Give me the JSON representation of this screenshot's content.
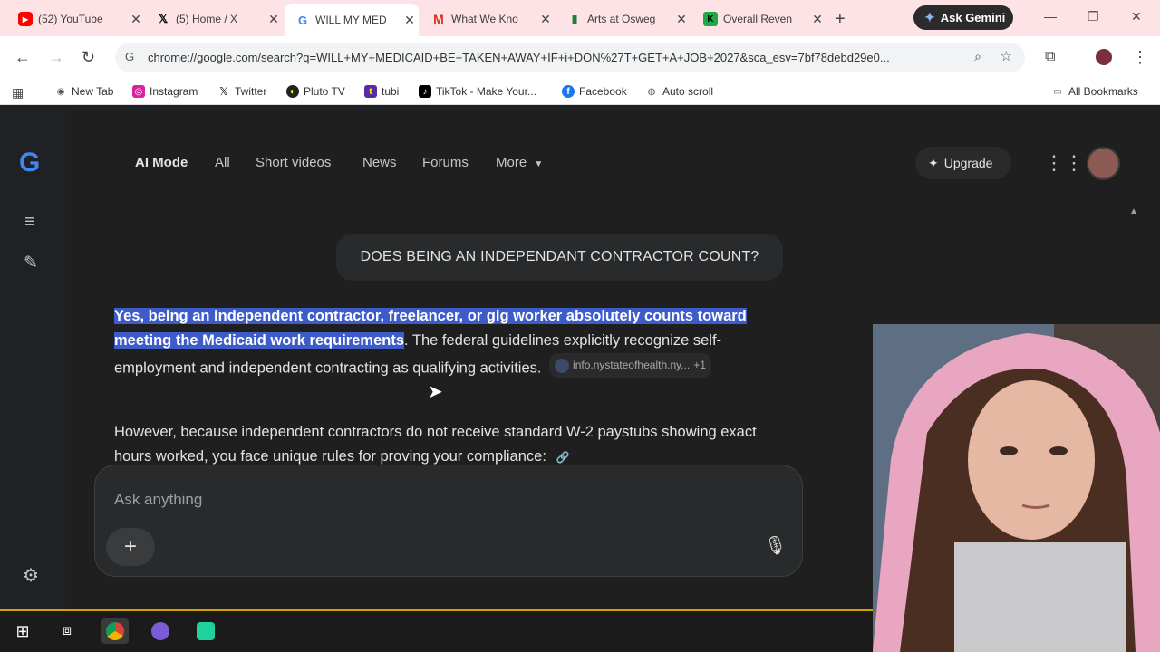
{
  "tabs": [
    {
      "title": "(52) YouTube",
      "icon": "youtube-icon",
      "active": false
    },
    {
      "title": "(5) Home / X",
      "icon": "x-logo-icon",
      "active": false
    },
    {
      "title": "WILL MY MED",
      "icon": "google-g-icon",
      "active": true
    },
    {
      "title": "What We Kno",
      "icon": "gmail-icon",
      "active": false
    },
    {
      "title": "Arts at Osweg",
      "icon": "bookmark-green-icon",
      "active": false
    },
    {
      "title": "Overall Reven",
      "icon": "k-logo-icon",
      "active": false
    }
  ],
  "gemini_label": "Ask Gemini",
  "url": "chrome://google.com/search?q=WILL+MY+MEDICAID+BE+TAKEN+AWAY+IF+i+DON%27T+GET+A+JOB+2027&sca_esv=7bf78debd29e0...",
  "url_display": "chrome://google.com/search?q=WILL+MY+MEDICAID+BE+TAKEN+AWAY+IF+i+DON%27T+GET+A+JOB+2027&sca_esv=7bf78debd29e0...",
  "bookmarks": [
    "New Tab",
    "Instagram",
    "Twitter",
    "Pluto TV",
    "tubi",
    "TikTok - Make Your...",
    "Facebook",
    "Auto scroll"
  ],
  "all_bookmarks": "All Bookmarks",
  "nav": {
    "ai_mode": "AI Mode",
    "all": "All",
    "short_videos": "Short videos",
    "news": "News",
    "forums": "Forums",
    "more": "More"
  },
  "upgrade_label": "Upgrade",
  "query": "DOES BEING AN INDEPENDANT CONTRACTOR COUNT?",
  "answer": {
    "highlight": "Yes, being an independent contractor, freelancer, or gig worker absolutely counts toward meeting the Medicaid work requirements",
    "rest": ". The federal guidelines explicitly recognize self-employment and independent contracting as qualifying activities.",
    "citation": "info.nystateofhealth.ny...",
    "citation_extra": "+1",
    "p2": "However, because independent contractors do not receive standard W-2 paystubs showing exact hours worked, you face unique rules for proving your compliance:"
  },
  "ask_placeholder": "Ask anything",
  "colors": {
    "page_bg": "#1f1f1f",
    "highlight": "#3d5cc9",
    "tabstrip": "#fde2e6",
    "taskbar_accent": "#d4a300"
  }
}
